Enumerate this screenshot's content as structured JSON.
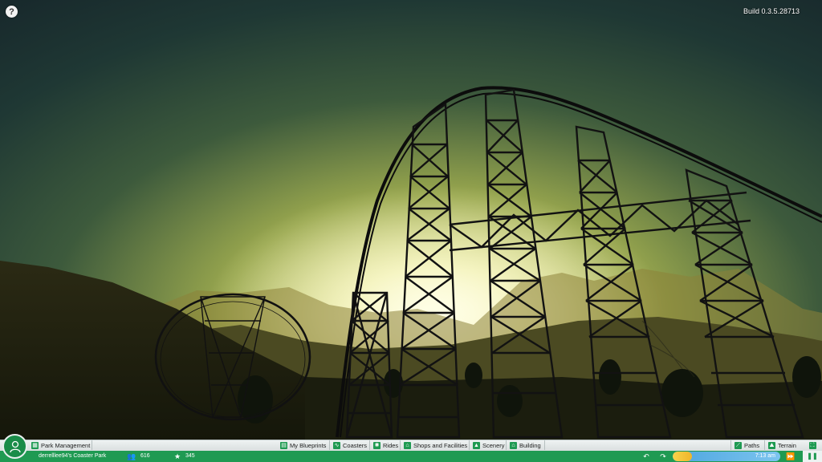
{
  "hud": {
    "help_label": "?",
    "build": "Build 0.3.5.28713"
  },
  "toolbar": {
    "park_management": "Park Management",
    "my_blueprints": "My Blueprints",
    "coasters": "Coasters",
    "rides": "Rides",
    "shops_facilities": "Shops and Facilities",
    "scenery": "Scenery",
    "building": "Building",
    "paths": "Paths",
    "terrain": "Terrain"
  },
  "status": {
    "park_name": "derrelllee94's Coaster Park",
    "guests": "616",
    "rating": "345",
    "time": "7:13 am",
    "day_progress": 0.18
  },
  "colors": {
    "accent": "#1f9a52",
    "toolbar_bg": "#e6ebeb"
  },
  "icons": {
    "guests": "people-icon",
    "rating": "star-icon",
    "undo": "undo-icon",
    "redo": "redo-icon",
    "fast_forward": "fast-forward-icon",
    "pause": "pause-icon"
  }
}
